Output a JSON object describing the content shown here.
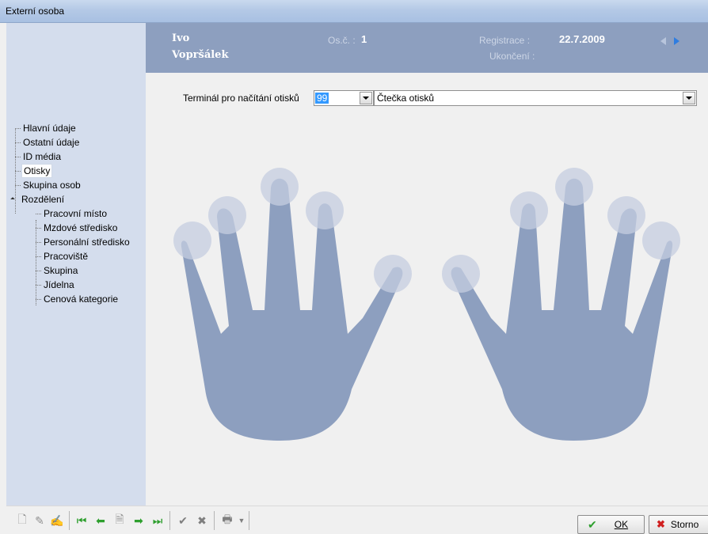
{
  "window": {
    "title": "Externí osoba"
  },
  "header": {
    "first_name": "Ivo",
    "last_name": "Vopršálek",
    "os_c_label": "Os.č. :",
    "os_c_value": "1",
    "registrace_label": "Registrace :",
    "registrace_value": "22.7.2009",
    "ukonceni_label": "Ukončení :"
  },
  "sidebar": {
    "items": [
      {
        "label": "Hlavní údaje"
      },
      {
        "label": "Ostatní údaje"
      },
      {
        "label": "ID média"
      },
      {
        "label": "Otisky",
        "selected": true
      },
      {
        "label": "Skupina osob"
      },
      {
        "label": "Rozdělení",
        "expanded": true
      },
      {
        "label": "Pracovní místo"
      },
      {
        "label": "Mzdové středisko"
      },
      {
        "label": "Personální středisko"
      },
      {
        "label": "Pracoviště"
      },
      {
        "label": "Skupina"
      },
      {
        "label": "Jídelna"
      },
      {
        "label": "Cenová kategorie"
      }
    ]
  },
  "fingerprint": {
    "terminal_label": "Terminál pro načítání otisků",
    "terminal_id": "99",
    "terminal_name": "Čtečka otisků"
  },
  "toolbar": {
    "icons": [
      "new-icon",
      "edit-icon",
      "edit-note-icon",
      "first-icon",
      "prev-icon",
      "detail-icon",
      "next-icon",
      "last-icon",
      "confirm-icon",
      "cancel-icon",
      "print-icon"
    ],
    "ok_label": "OK",
    "storno_label": "Storno"
  },
  "colors": {
    "sidebar_bg": "#d4dded",
    "header_bg": "#8d9fbf",
    "hand": "#8d9fbf",
    "fingertip": "#c5cde0"
  }
}
